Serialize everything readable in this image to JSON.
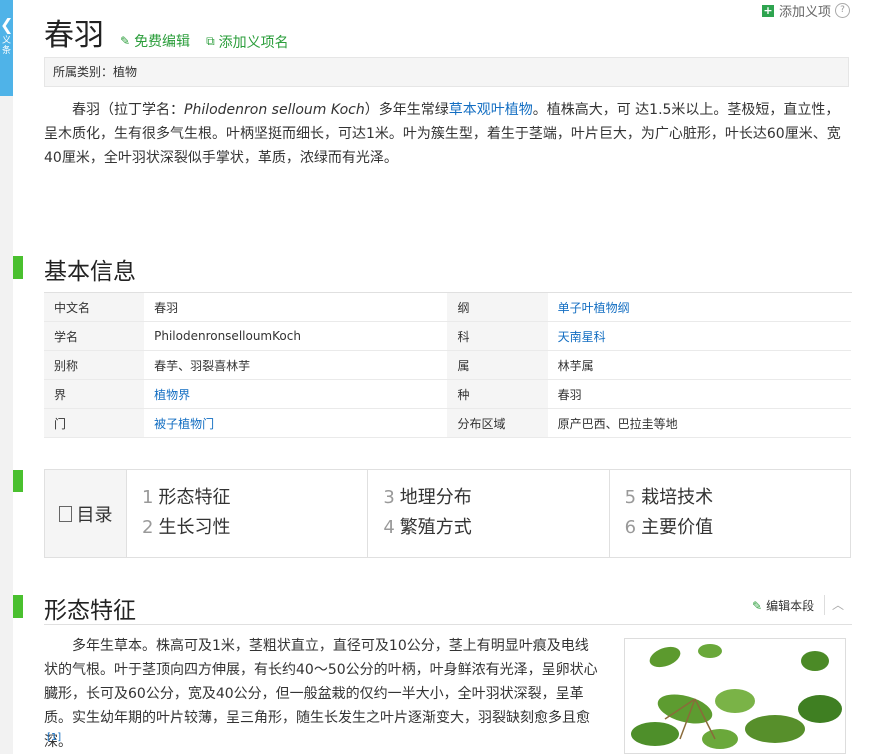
{
  "side_tab": {
    "text": "义条"
  },
  "top_add": {
    "label": "添加义项",
    "help": "?"
  },
  "header": {
    "title": "春羽",
    "edit_label": "免费编辑",
    "add_name_label": "添加义项名"
  },
  "category": "所属类别：植物",
  "summary": {
    "p1": "春羽（拉丁学名：",
    "latin": "Philodenron selloum Koch",
    "p2": "）多年生常绿",
    "link": "草本观叶植物",
    "p3": "。植株高大，可 达1.5米以上。茎极短，直立性，呈木质化，生有很多气生根。叶柄坚挺而细长，可达1米。叶为簇生型，着生于茎端，叶片巨大，为广心脏形，叶长达60厘米、宽40厘米，全叶羽状深裂似手掌状，革质，浓绿而有光泽。"
  },
  "basic_info": {
    "title": "基本信息",
    "rows": [
      {
        "k1": "中文名",
        "v1": "春羽",
        "l1": false,
        "k2": "纲",
        "v2": "单子叶植物纲",
        "l2": true
      },
      {
        "k1": "学名",
        "v1": "PhilodenronselloumKoch",
        "l1": false,
        "k2": "科",
        "v2": "天南星科",
        "l2": true
      },
      {
        "k1": "别称",
        "v1": "春芋、羽裂喜林芋",
        "l1": false,
        "k2": "属",
        "v2": "林芋属",
        "l2": false
      },
      {
        "k1": "界",
        "v1": "植物界",
        "l1": true,
        "k2": "种",
        "v2": "春羽",
        "l2": false
      },
      {
        "k1": "门",
        "v1": "被子植物门",
        "l1": true,
        "k2": "分布区域",
        "v2": "原产巴西、巴拉圭等地",
        "l2": false
      }
    ]
  },
  "toc": {
    "label": "目录",
    "items": [
      {
        "n": "1",
        "t": "形态特征"
      },
      {
        "n": "2",
        "t": "生长习性"
      },
      {
        "n": "3",
        "t": "地理分布"
      },
      {
        "n": "4",
        "t": "繁殖方式"
      },
      {
        "n": "5",
        "t": "栽培技术"
      },
      {
        "n": "6",
        "t": "主要价值"
      }
    ]
  },
  "morphology": {
    "title": "形态特征",
    "edit_label": "编辑本段",
    "text": "多年生草本。株高可及1米，茎粗状直立，直径可及10公分，茎上有明显叶痕及电线状的气根。叶于茎顶向四方伸展，有长约40～50公分的叶柄，叶身鲜浓有光泽，呈卵状心臓形，长可及60公分，宽及40公分，但一般盆栽的仅约一半大小，全叶羽状深裂，呈革质。实生幼年期的叶片较薄，呈三角形，随生长发生之叶片逐渐变大，羽裂缺刻愈多且愈深。",
    "ref": "[1]"
  },
  "colors": {
    "accent_green": "#4ac02f",
    "link_blue": "#136ec2",
    "edit_green": "#2a9d3a",
    "side_blue": "#4fb3e8"
  }
}
